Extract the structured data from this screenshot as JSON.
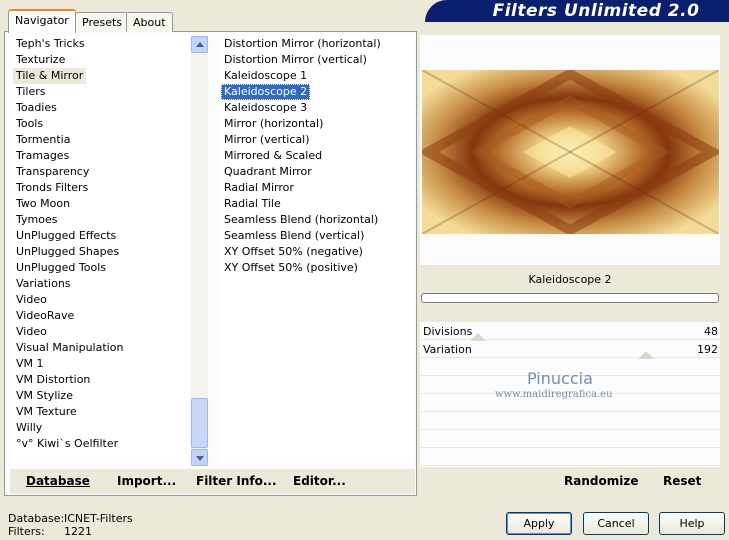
{
  "tabs": [
    "Navigator",
    "Presets",
    "About"
  ],
  "banner_title": "Filters Unlimited 2.0",
  "categories": [
    "Teph's Tricks",
    "Texturize",
    "Tile & Mirror",
    "Tilers",
    "Toadies",
    "Tools",
    "Tormentia",
    "Tramages",
    "Transparency",
    "Tronds Filters",
    "Two Moon",
    "Tymoes",
    "UnPlugged Effects",
    "UnPlugged Shapes",
    "UnPlugged Tools",
    "Variations",
    "Video",
    "VideoRave",
    "Video",
    "Visual Manipulation",
    "VM 1",
    "VM Distortion",
    "VM Stylize",
    "VM Texture",
    "Willy",
    "°v° Kiwi`s Oelfilter"
  ],
  "selected_category": "Tile & Mirror",
  "filters": [
    "Distortion Mirror (horizontal)",
    "Distortion Mirror (vertical)",
    "Kaleidoscope 1",
    "Kaleidoscope 2",
    "Kaleidoscope 3",
    "Mirror (horizontal)",
    "Mirror (vertical)",
    "Mirrored & Scaled",
    "Quadrant Mirror",
    "Radial Mirror",
    "Radial Tile",
    "Seamless Blend (horizontal)",
    "Seamless Blend (vertical)",
    "XY Offset 50% (negative)",
    "XY Offset 50% (positive)"
  ],
  "selected_filter": "Kaleidoscope 2",
  "bottom_buttons": {
    "database": "Database",
    "import": "Import...",
    "filter_info": "Filter Info...",
    "editor": "Editor...",
    "randomize": "Randomize",
    "reset": "Reset"
  },
  "preview": {
    "filter_name": "Kaleidoscope 2",
    "progress": 0
  },
  "params": [
    {
      "label": "Divisions",
      "value": "48",
      "level": 48
    },
    {
      "label": "Variation",
      "value": "192",
      "level": 192
    }
  ],
  "watermark": {
    "line1": "Pinuccia",
    "line2": "www.maidiregrafica.eu"
  },
  "footer": {
    "database_label": "Database:",
    "database_value": "ICNET-Filters",
    "filters_label": "Filters:",
    "filters_value": "1221"
  },
  "dialog_buttons": {
    "apply": "Apply",
    "cancel": "Cancel",
    "help": "Help"
  },
  "colors": {
    "selection": "#316ac5",
    "banner": "#0a1f6e",
    "active_tab_accent": "#e68b2c"
  }
}
